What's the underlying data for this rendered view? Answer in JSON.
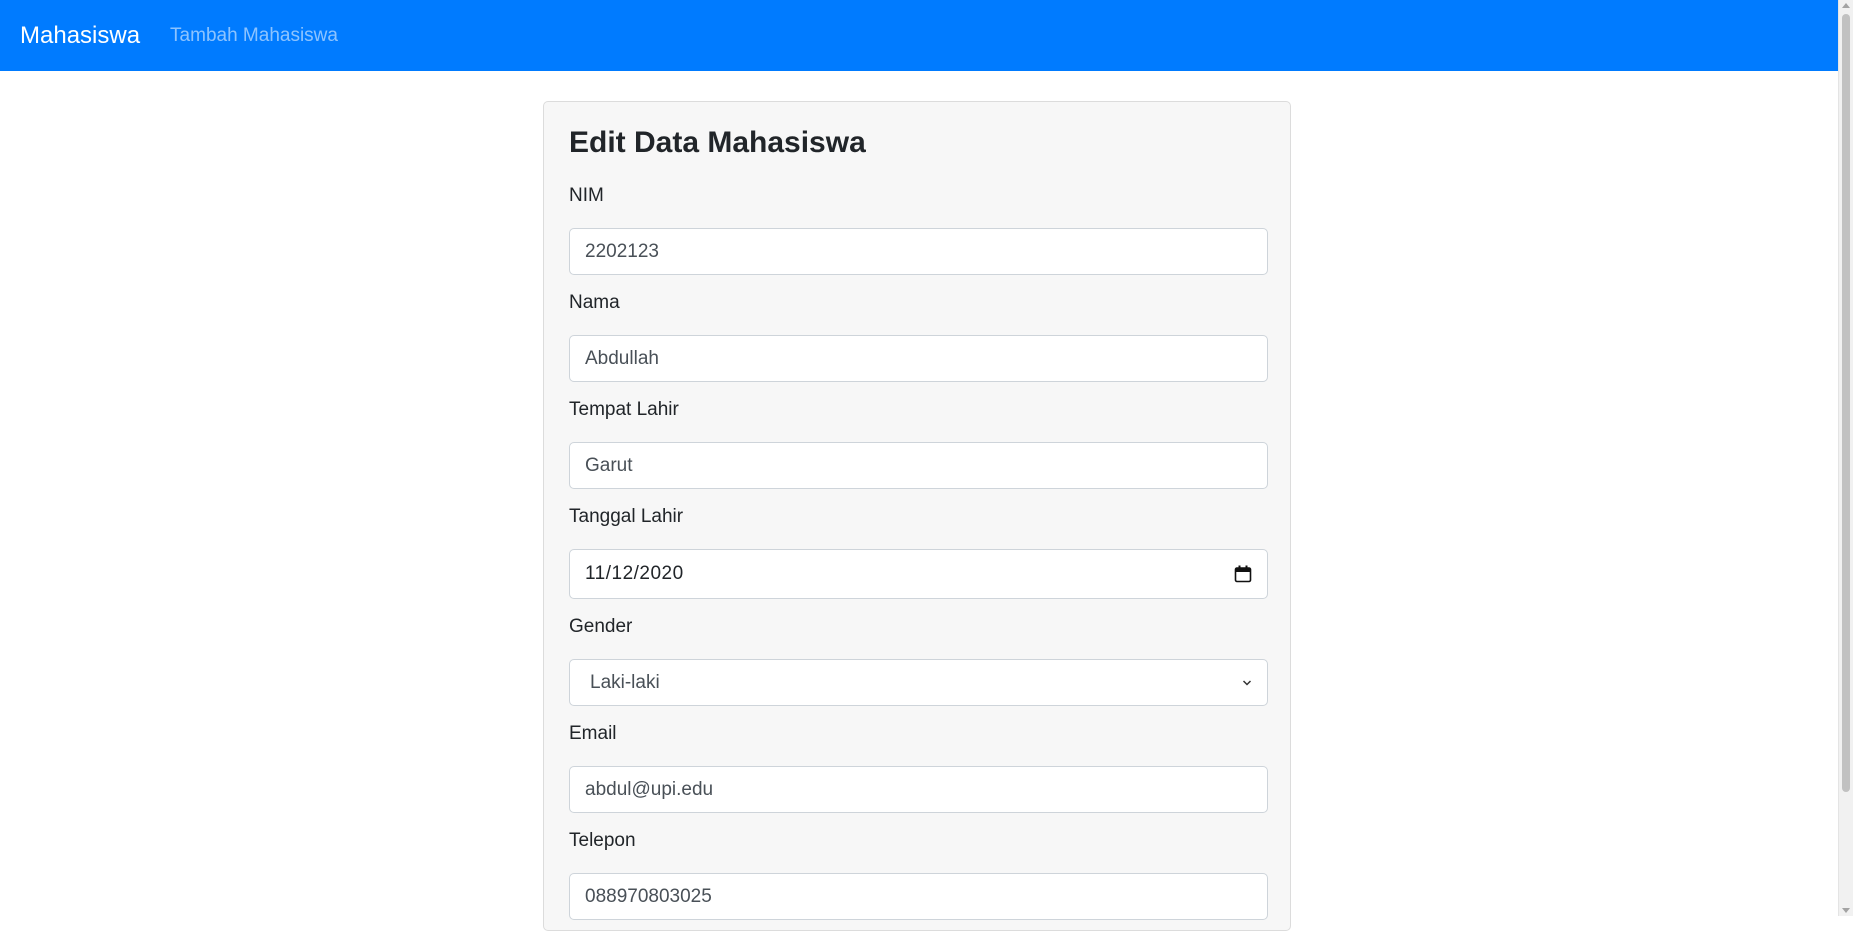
{
  "navbar": {
    "brand": "Mahasiswa",
    "links": [
      "Tambah Mahasiswa"
    ]
  },
  "form": {
    "title": "Edit Data Mahasiswa",
    "fields": [
      {
        "label": "NIM",
        "value": "2202123"
      },
      {
        "label": "Nama",
        "value": "Abdullah"
      },
      {
        "label": "Tempat Lahir",
        "value": "Garut"
      },
      {
        "label": "Tanggal Lahir",
        "value": "11/12/2020",
        "icon": "calendar-icon"
      },
      {
        "label": "Gender",
        "value": "Laki-laki",
        "icon": "chevron-down-icon"
      },
      {
        "label": "Email",
        "value": "abdul@upi.edu"
      },
      {
        "label": "Telepon",
        "value": "088970803025"
      }
    ]
  },
  "colors": {
    "navbar": "#007bff",
    "card_bg": "#f7f7f7",
    "input_border": "#ced4da"
  }
}
